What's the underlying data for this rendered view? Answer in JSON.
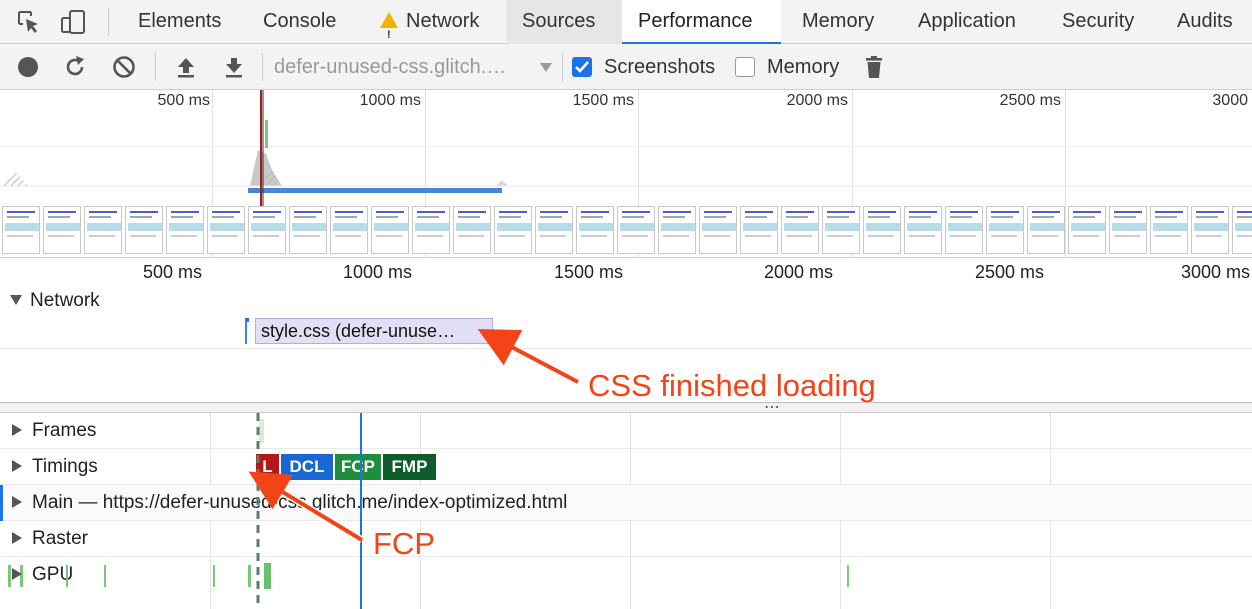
{
  "tabs": [
    {
      "label": "Elements"
    },
    {
      "label": "Console"
    },
    {
      "label": "Network"
    },
    {
      "label": "Sources"
    },
    {
      "label": "Performance"
    },
    {
      "label": "Memory"
    },
    {
      "label": "Application"
    },
    {
      "label": "Security"
    },
    {
      "label": "Audits"
    }
  ],
  "toolbar": {
    "url_select": "defer-unused-css.glitch.…",
    "screenshots_label": "Screenshots",
    "screenshots_checked": true,
    "memory_label": "Memory",
    "memory_checked": false
  },
  "overview": {
    "ticks": [
      "500 ms",
      "1000 ms",
      "1500 ms",
      "2000 ms",
      "2500 ms",
      "3000"
    ]
  },
  "ruler": {
    "ticks": [
      "500 ms",
      "1000 ms",
      "1500 ms",
      "2000 ms",
      "2500 ms",
      "3000 ms"
    ]
  },
  "network": {
    "title": "Network",
    "request": "style.css (defer-unuse…"
  },
  "tracks": {
    "frames": "Frames",
    "timings": "Timings",
    "main": "Main — https://defer-unused-css.glitch.me/index-optimized.html",
    "raster": "Raster",
    "gpu": "GPU"
  },
  "timings": [
    {
      "label": "L",
      "color": "#b51717"
    },
    {
      "label": "DCL",
      "color": "#1967d2"
    },
    {
      "label": "FCP",
      "color": "#1e8e3e"
    },
    {
      "label": "FMP",
      "color": "#0d5c2a"
    }
  ],
  "annotations": {
    "css": "CSS finished loading",
    "fcp": "FCP"
  },
  "colors": {
    "accent": "#1a73e8",
    "annotation": "#f24418"
  }
}
